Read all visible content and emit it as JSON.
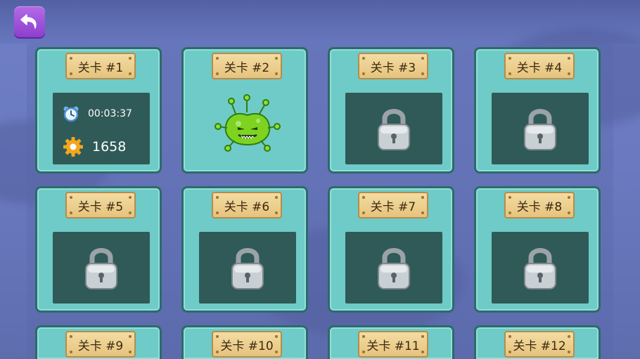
{
  "levels": [
    {
      "label": "关卡 #1",
      "state": "completed",
      "time": "00:03:37",
      "score": "1658"
    },
    {
      "label": "关卡 #2",
      "state": "current"
    },
    {
      "label": "关卡 #3",
      "state": "locked"
    },
    {
      "label": "关卡 #4",
      "state": "locked"
    },
    {
      "label": "关卡 #5",
      "state": "locked"
    },
    {
      "label": "关卡 #6",
      "state": "locked"
    },
    {
      "label": "关卡 #7",
      "state": "locked"
    },
    {
      "label": "关卡 #8",
      "state": "locked"
    },
    {
      "label": "关卡 #9",
      "state": "locked"
    },
    {
      "label": "关卡 #10",
      "state": "locked"
    },
    {
      "label": "关卡 #11",
      "state": "locked"
    },
    {
      "label": "关卡 #12",
      "state": "locked"
    }
  ],
  "icons": {
    "back": "undo-arrow-icon",
    "clock": "alarm-clock-icon",
    "score": "gear-icon",
    "locked": "padlock-icon",
    "current": "green-slime-monster-icon"
  },
  "colors": {
    "card": "#6fcbc7",
    "card_border": "#2e6a6a",
    "inner_panel": "#2f5a57",
    "plate": "#e6c37d",
    "back_button": "#a054dc",
    "background": "#6b7ac0"
  }
}
